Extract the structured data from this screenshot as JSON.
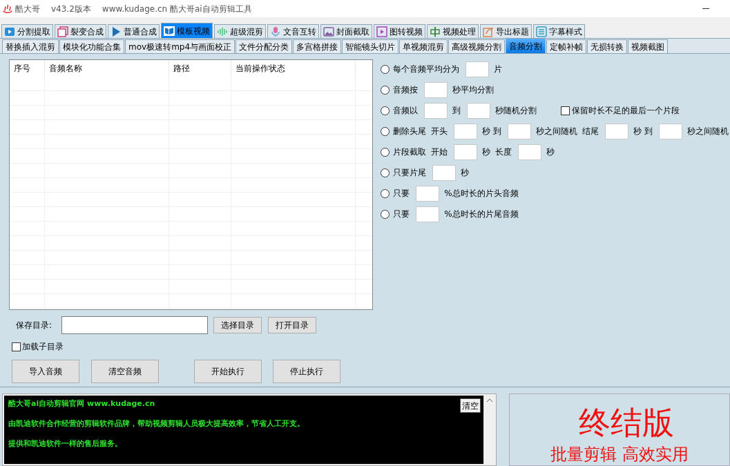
{
  "window": {
    "app_name": "酷大哥",
    "version": "v43.2版本",
    "title": "www.kudage.cn 酷大哥ai自动剪辑工具"
  },
  "main_tabs": [
    {
      "label": "分割提取",
      "selected": false
    },
    {
      "label": "裂变合成",
      "selected": false
    },
    {
      "label": "普通合成",
      "selected": false
    },
    {
      "label": "模板视频",
      "selected": true
    },
    {
      "label": "超级混剪",
      "selected": false
    },
    {
      "label": "文音互转",
      "selected": false
    },
    {
      "label": "封面截取",
      "selected": false
    },
    {
      "label": "图转视频",
      "selected": false
    },
    {
      "label": "视频处理",
      "selected": false
    },
    {
      "label": "导出标题",
      "selected": false
    },
    {
      "label": "字幕样式",
      "selected": false
    }
  ],
  "sub_tabs": [
    {
      "label": "替换插入混剪",
      "selected": false
    },
    {
      "label": "模块化功能合集",
      "selected": false
    },
    {
      "label": "mov极速转mp4与画面校正",
      "selected": false
    },
    {
      "label": "文件分配分类",
      "selected": false
    },
    {
      "label": "多宫格拼接",
      "selected": false
    },
    {
      "label": "智能镜头切片",
      "selected": false
    },
    {
      "label": "单视频混剪",
      "selected": false
    },
    {
      "label": "高级视频分割",
      "selected": false
    },
    {
      "label": "音频分割",
      "selected": true
    },
    {
      "label": "定帧补帧",
      "selected": false
    },
    {
      "label": "无损转换",
      "selected": false
    },
    {
      "label": "视频截图",
      "selected": false
    }
  ],
  "table": {
    "columns": [
      "序号",
      "音频名称",
      "路径",
      "当前操作状态"
    ]
  },
  "options": [
    {
      "selected": false,
      "parts": [
        {
          "kind": "label",
          "text": "每个音频平均分为"
        },
        {
          "kind": "input"
        },
        {
          "kind": "label",
          "text": "片"
        }
      ]
    },
    {
      "selected": false,
      "parts": [
        {
          "kind": "label",
          "text": "音频按"
        },
        {
          "kind": "input"
        },
        {
          "kind": "label",
          "text": "秒平均分割"
        }
      ]
    },
    {
      "selected": false,
      "parts": [
        {
          "kind": "label",
          "text": "音频以"
        },
        {
          "kind": "input"
        },
        {
          "kind": "label",
          "text": "到"
        },
        {
          "kind": "input"
        },
        {
          "kind": "label",
          "text": "秒随机分割"
        },
        {
          "kind": "checkbox",
          "text": "保留时长不足的最后一个片段",
          "checked": false
        }
      ]
    },
    {
      "selected": false,
      "parts": [
        {
          "kind": "label",
          "text": "删除头尾"
        },
        {
          "kind": "label",
          "text": "开头"
        },
        {
          "kind": "input"
        },
        {
          "kind": "label",
          "text": "秒 到"
        },
        {
          "kind": "input"
        },
        {
          "kind": "label",
          "text": "秒之间随机"
        },
        {
          "kind": "label",
          "text": "结尾"
        },
        {
          "kind": "input"
        },
        {
          "kind": "label",
          "text": "秒 到"
        },
        {
          "kind": "input"
        },
        {
          "kind": "label",
          "text": "秒之间随机"
        }
      ]
    },
    {
      "selected": false,
      "parts": [
        {
          "kind": "label",
          "text": "片段截取"
        },
        {
          "kind": "label",
          "text": "开始"
        },
        {
          "kind": "input"
        },
        {
          "kind": "label",
          "text": "秒"
        },
        {
          "kind": "label",
          "text": "长度"
        },
        {
          "kind": "input"
        },
        {
          "kind": "label",
          "text": "秒"
        }
      ]
    },
    {
      "selected": false,
      "parts": [
        {
          "kind": "label",
          "text": "只要片尾"
        },
        {
          "kind": "input"
        },
        {
          "kind": "label",
          "text": "秒"
        }
      ]
    },
    {
      "selected": false,
      "parts": [
        {
          "kind": "label",
          "text": "只要"
        },
        {
          "kind": "input"
        },
        {
          "kind": "label",
          "text": "%总时长的片头音频"
        }
      ]
    },
    {
      "selected": false,
      "parts": [
        {
          "kind": "label",
          "text": "只要"
        },
        {
          "kind": "input"
        },
        {
          "kind": "label",
          "text": "%总时长的片尾音频"
        }
      ]
    }
  ],
  "save_dir": {
    "label": "保存目录:",
    "choose_button": "选择目录",
    "open_button": "打开目录"
  },
  "load_subdirs": {
    "label": "加载子目录",
    "checked": false
  },
  "actions": [
    "导入音频",
    "清空音频",
    "开始执行",
    "停止执行"
  ],
  "log": {
    "lines": [
      "酷大哥ai自动剪辑官网  www.kudage.cn",
      "由凯迪软件合作经营的剪辑软件品牌，帮助视频剪辑人员极大提高效率，节省人工开支。",
      "提供和凯迪软件一样的售后服务。"
    ],
    "clear_button": "清空"
  },
  "promo": {
    "headline": "终结版",
    "tagline": "批量剪辑 高效实用"
  }
}
